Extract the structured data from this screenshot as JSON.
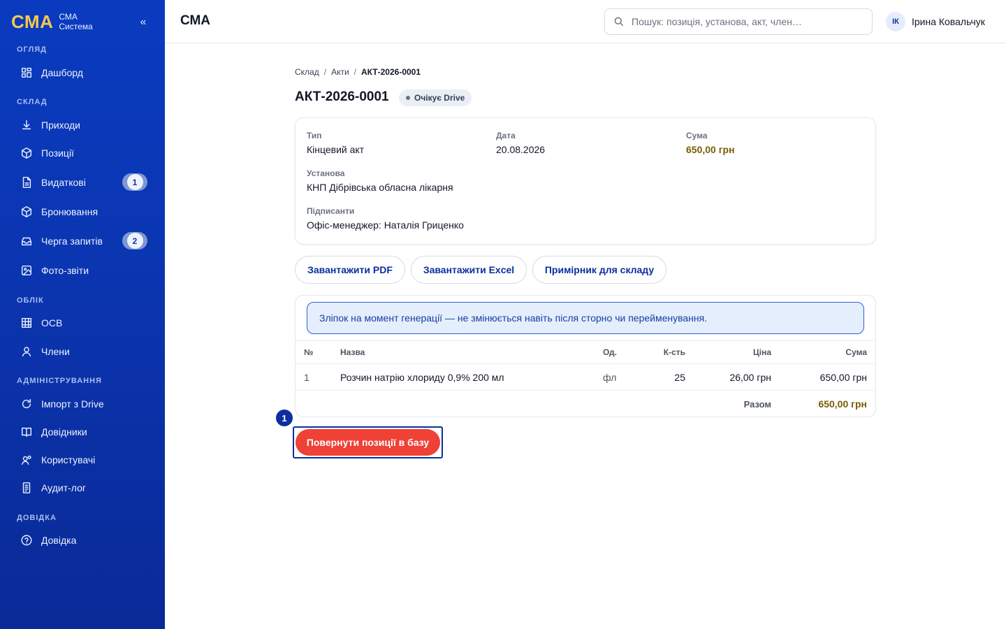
{
  "brand": {
    "logo": "СМА",
    "sub_line1": "СМА",
    "sub_line2": "Система",
    "collapse": "«"
  },
  "sidebar": {
    "sections": [
      {
        "label": "ОГЛЯД"
      },
      {
        "label": "СКЛАД"
      },
      {
        "label": "ОБЛІК"
      },
      {
        "label": "АДМІНІСТРУВАННЯ"
      },
      {
        "label": "ДОВІДКА"
      }
    ],
    "items": [
      {
        "label": "Дашборд",
        "icon": "grid-icon"
      },
      {
        "label": "Приходи",
        "icon": "download-icon"
      },
      {
        "label": "Позиції",
        "icon": "box-icon"
      },
      {
        "label": "Видаткові",
        "icon": "document-icon",
        "badge": "1"
      },
      {
        "label": "Бронювання",
        "icon": "box-icon"
      },
      {
        "label": "Черга запитів",
        "icon": "inbox-icon",
        "badge": "2"
      },
      {
        "label": "Фото-звіти",
        "icon": "image-icon"
      },
      {
        "label": "ОСВ",
        "icon": "table-icon"
      },
      {
        "label": "Члени",
        "icon": "user-icon"
      },
      {
        "label": "Імпорт з Drive",
        "icon": "refresh-icon"
      },
      {
        "label": "Довідники",
        "icon": "book-icon"
      },
      {
        "label": "Користувачі",
        "icon": "users-icon"
      },
      {
        "label": "Аудит-лог",
        "icon": "log-icon"
      },
      {
        "label": "Довідка",
        "icon": "help-icon"
      }
    ]
  },
  "header": {
    "title": "СМА",
    "search_placeholder": "Пошук: позиція, установа, акт, член…",
    "user_initials": "ІК",
    "user_name": "Ірина Ковальчук"
  },
  "breadcrumb": [
    "Склад",
    "Акти",
    "АКТ-2026-0001"
  ],
  "page": {
    "title": "АКТ-2026-0001",
    "status": "Очікує Drive"
  },
  "details": {
    "type_label": "Тип",
    "type_value": "Кінцевий акт",
    "date_label": "Дата",
    "date_value": "20.08.2026",
    "sum_label": "Сума",
    "sum_value": "650,00 грн",
    "institution_label": "Установа",
    "institution_value": "КНП Дібрівська обласна лікарня",
    "signers_label": "Підписанти",
    "signers_value": "Офіс-менеджер: Наталія Гриценко"
  },
  "actions": {
    "pdf": "Завантажити PDF",
    "excel": "Завантажити Excel",
    "warehouse_copy": "Примірник для складу"
  },
  "snapshot_notice": "Зліпок на момент генерації — не змінюється навіть після сторно чи перейменування.",
  "table": {
    "headers": {
      "num": "№",
      "name": "Назва",
      "unit": "Од.",
      "qty": "К-сть",
      "price": "Ціна",
      "sum": "Сума"
    },
    "rows": [
      {
        "num": "1",
        "name": "Розчин натрію хлориду 0,9% 200 мл",
        "unit": "фл",
        "qty": "25",
        "price": "26,00 грн",
        "sum": "650,00 грн"
      }
    ],
    "total_label": "Разом",
    "total_value": "650,00 грн"
  },
  "return_button": "Повернути позиції в базу",
  "step_marker": "1",
  "colors": {
    "accent": "#0b35b0",
    "danger": "#ef4136",
    "money": "#7a5c00",
    "logo": "#f5c84c"
  }
}
